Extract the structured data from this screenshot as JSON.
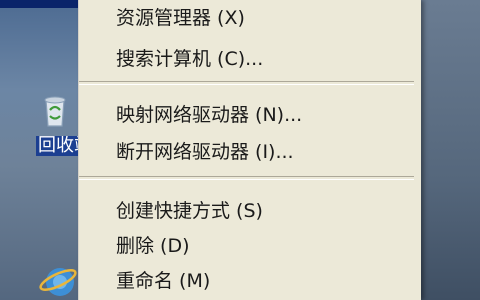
{
  "top_item_label": "",
  "desktop": {
    "recycle_bin_label": "回收站",
    "ie_label": "Internet Explorer"
  },
  "menu": {
    "items": [
      {
        "label": "资源管理器 (X)"
      },
      {
        "label": "搜索计算机 (C)..."
      },
      {
        "label": "映射网络驱动器 (N)..."
      },
      {
        "label": "断开网络驱动器 (I)..."
      },
      {
        "label": "创建快捷方式 (S)"
      },
      {
        "label": "删除 (D)"
      },
      {
        "label": "重命名 (M)"
      }
    ]
  },
  "colors": {
    "menu_bg": "#ece9d8",
    "selection": "#0a246a",
    "desktop": "#5d6f86"
  },
  "icons": [
    "recycle-bin-icon",
    "internet-explorer-icon"
  ]
}
